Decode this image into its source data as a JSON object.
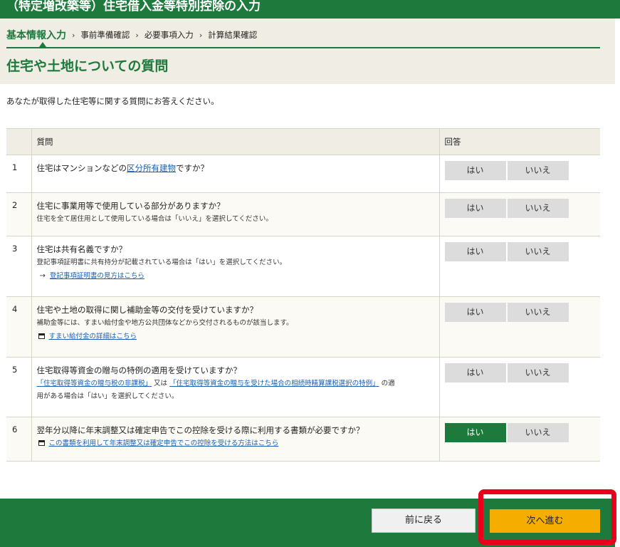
{
  "header": {
    "title": "（特定増改築等）住宅借入金等特別控除の入力"
  },
  "steps": [
    {
      "label": "基本情報入力",
      "active": true
    },
    {
      "label": "事前準備確認",
      "active": false
    },
    {
      "label": "必要事項入力",
      "active": false
    },
    {
      "label": "計算結果確認",
      "active": false
    }
  ],
  "step_separator": "›",
  "page_title": "住宅や土地についての質問",
  "intro": "あなたが取得した住宅等に関する質問にお答えください。",
  "table": {
    "col_question": "質問",
    "col_answer": "回答",
    "yes_label": "はい",
    "no_label": "いいえ",
    "rows": [
      {
        "no": "1",
        "q_pre": "住宅はマンションなどの",
        "q_link": "区分所有建物",
        "q_post": "ですか？"
      },
      {
        "no": "2",
        "question": "住宅に事業用等で使用している部分がありますか？",
        "note": "住宅を全て居住用として使用している場合は「いいえ」を選択してください。"
      },
      {
        "no": "3",
        "question": "住宅は共有名義ですか？",
        "note": "登記事項証明書に共有持分が記載されている場合は「はい」を選択してください。",
        "arrow": "→",
        "link": "登記事項証明書の見方はこちら"
      },
      {
        "no": "4",
        "question": "住宅や土地の取得に関し補助金等の交付を受けていますか？",
        "note": "補助金等には、すまい給付金や地方公共団体などから交付されるものが該当します。",
        "link": "すまい給付金の詳細はこちら"
      },
      {
        "no": "5",
        "question": "住宅取得等資金の贈与の特例の適用を受けていますか？",
        "link1": "「住宅取得等資金の贈与税の非課税」",
        "mid": " 又は ",
        "link2": "「住宅取得等資金の贈与を受けた場合の相続時精算課税選択の特例」",
        "tail1": " の適",
        "tail2": "用がある場合は「はい」を選択してください。"
      },
      {
        "no": "6",
        "question": "翌年分以降に年末調整又は確定申告でこの控除を受ける際に利用する書類が必要ですか？",
        "link": "この書類を利用して年末調整又は確定申告でこの控除を受ける方法はこちら",
        "selected": "はい"
      }
    ]
  },
  "footer": {
    "back_label": "前に戻る",
    "next_label": "次へ進む"
  },
  "colors": {
    "brand_green": "#1e7a3c",
    "next_button": "#f5ad00",
    "highlight": "#e8001c"
  }
}
